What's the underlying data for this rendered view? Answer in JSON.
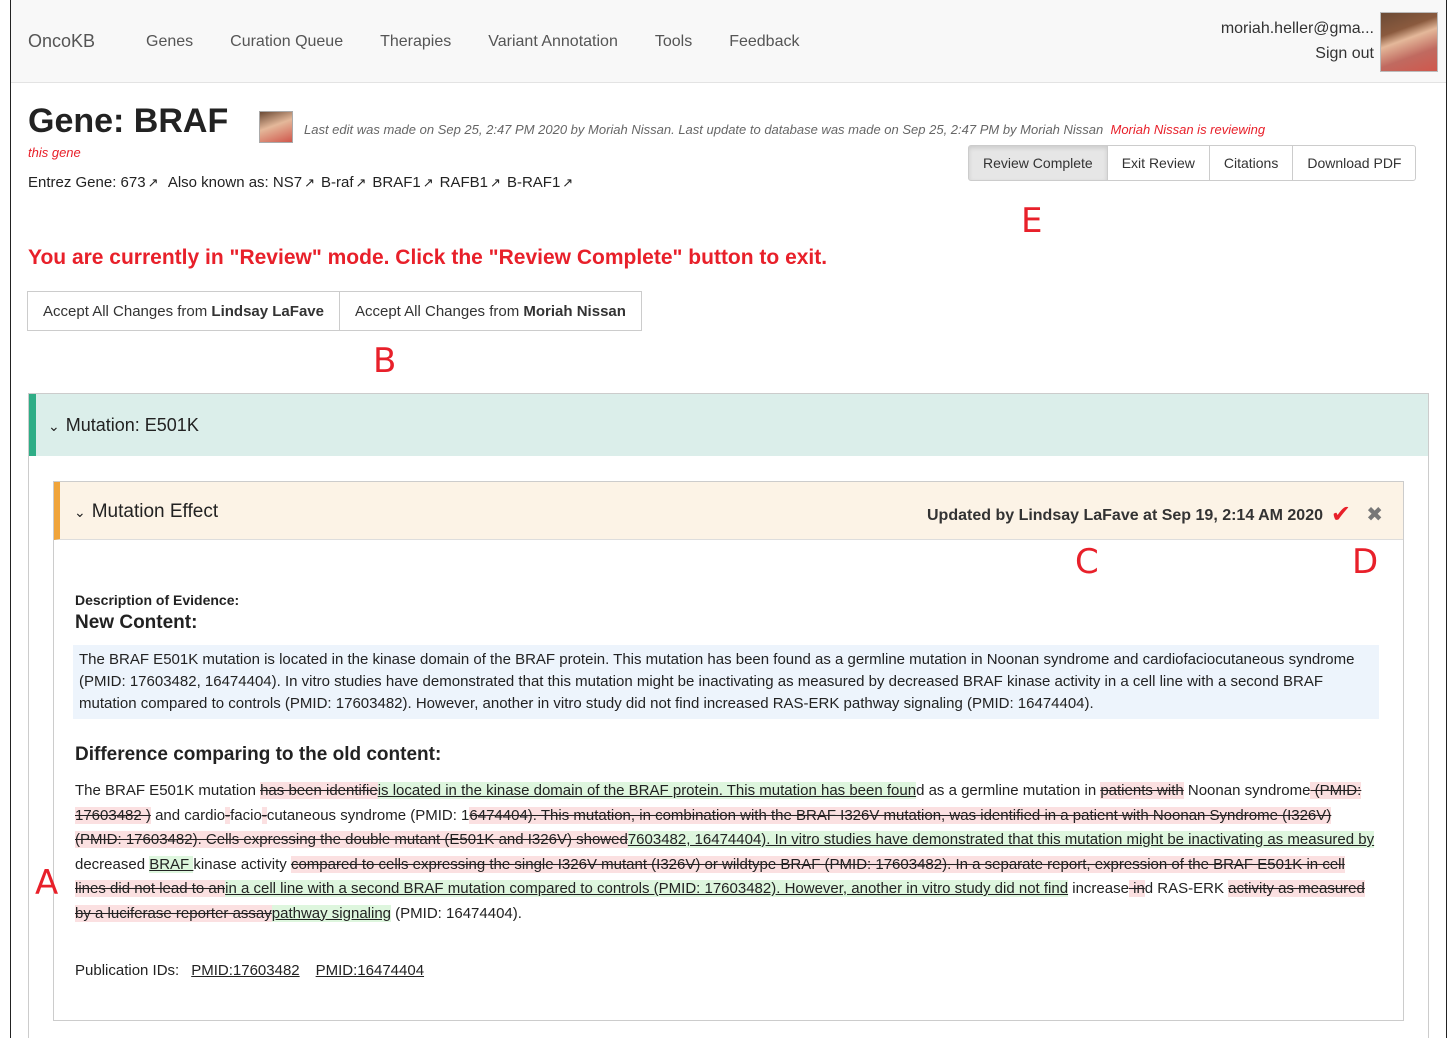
{
  "navbar": {
    "brand": "OncoKB",
    "links": [
      "Genes",
      "Curation Queue",
      "Therapies",
      "Variant Annotation",
      "Tools",
      "Feedback"
    ],
    "user_email": "moriah.heller@gma...",
    "sign_out": "Sign out"
  },
  "gene": {
    "title": "Gene: BRAF",
    "edit_info": "Last edit was made on Sep 25, 2:47 PM 2020 by Moriah Nissan.  Last update to database was made on Sep 25, 2:47 PM by Moriah Nissan",
    "reviewing_a": "Moriah Nissan is reviewing",
    "reviewing_b": "this gene",
    "entrez_label": "Entrez Gene: 673",
    "aka_label": "Also known as:",
    "aliases": [
      "NS7",
      "B-raf",
      "BRAF1",
      "RAFB1",
      "B-RAF1"
    ]
  },
  "toolbar": {
    "review_complete": "Review Complete",
    "exit_review": "Exit Review",
    "citations": "Citations",
    "download_pdf": "Download PDF"
  },
  "annotations": {
    "a": "A",
    "b": "B",
    "c": "C",
    "d": "D",
    "e": "E"
  },
  "review_message": "You are currently in \"Review\" mode. Click the \"Review Complete\" button to exit.",
  "accept": {
    "prefix": "Accept All Changes from",
    "user1": "Lindsay LaFave",
    "user2": "Moriah Nissan"
  },
  "mutation": {
    "title": "Mutation: E501K",
    "effect_title": "Mutation Effect",
    "updated_by": "Updated by Lindsay LaFave at Sep 19, 2:14 AM 2020",
    "description_label": "Description of Evidence:",
    "new_content_heading": "New Content:",
    "new_content": "The BRAF E501K mutation is located in the kinase domain of the BRAF protein. This mutation has been found as a germline mutation in Noonan syndrome and cardiofaciocutaneous syndrome (PMID:  17603482, 16474404). In vitro studies have demonstrated that this mutation might be inactivating as measured by decreased BRAF kinase activity in a cell line with a second BRAF mutation compared to controls (PMID: 17603482). However, another in vitro study did not find increased RAS-ERK pathway signaling (PMID: 16474404).",
    "diff_heading": "Difference comparing to the old content:",
    "diff": [
      {
        "t": "eq",
        "s": "The BRAF E501K mutation "
      },
      {
        "t": "del",
        "s": "has been identifie"
      },
      {
        "t": "ins",
        "s": "is located in the kinase domain of the BRAF protein. This mutation has been foun"
      },
      {
        "t": "eq",
        "s": "d as a germline mutation in "
      },
      {
        "t": "del",
        "s": "patients with"
      },
      {
        "t": "eq",
        "s": " Noonan syndrome"
      },
      {
        "t": "del",
        "s": " (PMID: 17603482 )"
      },
      {
        "t": "eq",
        "s": " and cardio"
      },
      {
        "t": "del",
        "s": "-"
      },
      {
        "t": "eq",
        "s": "facio"
      },
      {
        "t": "del",
        "s": "-"
      },
      {
        "t": "eq",
        "s": "cutaneous syndrome (PMID: 1"
      },
      {
        "t": "del",
        "s": "6474404). This mutation, in combination with the BRAF I326V mutation, was identified in a patient with Noonan Syndrome (I326V) (PMID: 17603482). Cells expressing the double mutant (E501K and I326V) showed"
      },
      {
        "t": "ins",
        "s": "7603482, 16474404). In vitro studies have demonstrated that this mutation might be inactivating as measured by"
      },
      {
        "t": "eq",
        "s": " decreased "
      },
      {
        "t": "ins",
        "s": "BRAF "
      },
      {
        "t": "eq",
        "s": "kinase activity "
      },
      {
        "t": "del",
        "s": "compared to cells expressing the single I326V mutant (I326V) or wildtype BRAF (PMID: 17603482). In a separate report, expression of the BRAF E501K in cell lines did not lead to an"
      },
      {
        "t": "ins",
        "s": "in a cell line with a second BRAF mutation compared to controls (PMID: 17603482). However, another in vitro study did not find"
      },
      {
        "t": "eq",
        "s": " increase"
      },
      {
        "t": "del",
        "s": " in"
      },
      {
        "t": "eq",
        "s": "d RAS-ERK "
      },
      {
        "t": "del",
        "s": "activity as measured by a luciferase reporter assay"
      },
      {
        "t": "ins",
        "s": "pathway signaling"
      },
      {
        "t": "eq",
        "s": " (PMID: 16474404)."
      }
    ],
    "pub_label": "Publication IDs:",
    "pubs": [
      "PMID:17603482",
      "PMID:16474404"
    ]
  }
}
